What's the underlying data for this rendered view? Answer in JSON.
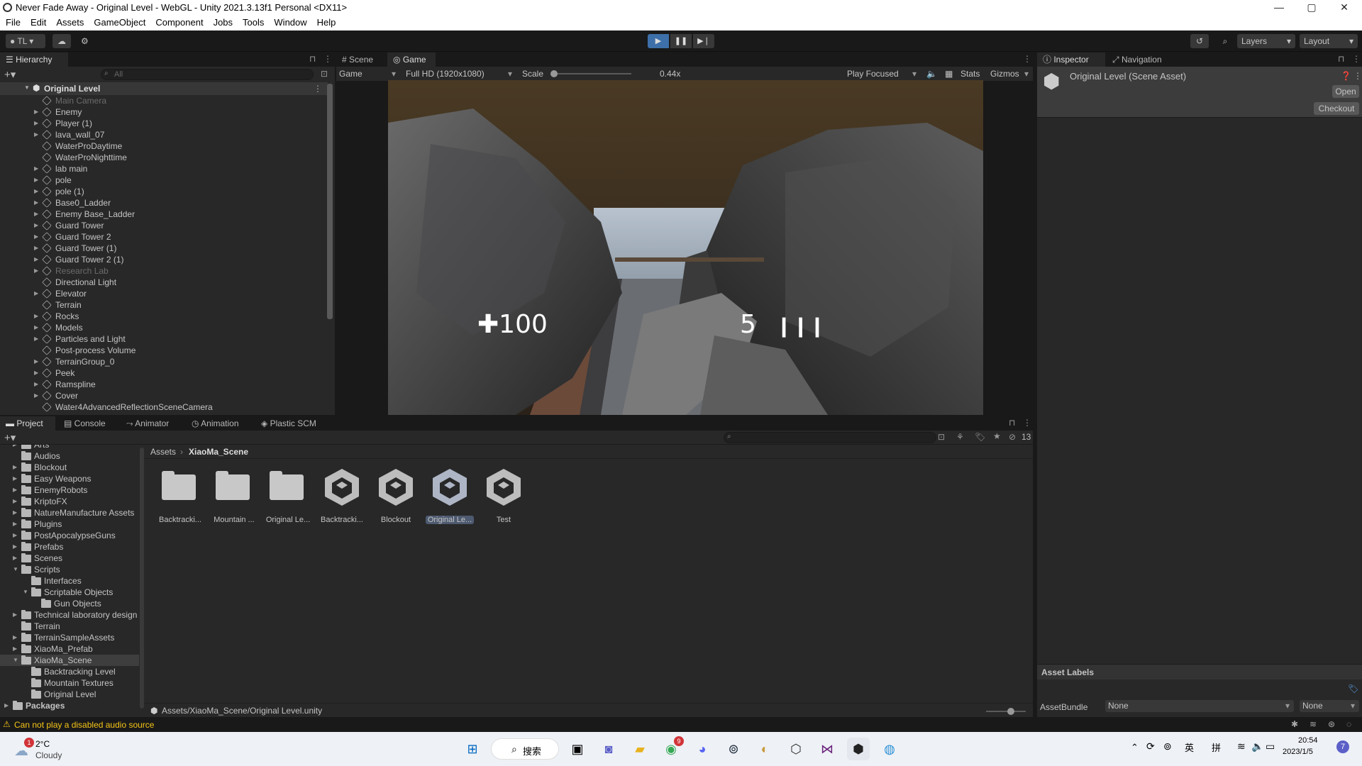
{
  "window": {
    "title": "Never Fade Away - Original Level - WebGL - Unity 2021.3.13f1 Personal <DX11>",
    "controls": [
      "—",
      "▢",
      "✕"
    ]
  },
  "menu": [
    "File",
    "Edit",
    "Assets",
    "GameObject",
    "Component",
    "Jobs",
    "Tools",
    "Window",
    "Help"
  ],
  "toolbar": {
    "account": "TL",
    "layers": "Layers",
    "layout": "Layout"
  },
  "hierarchy": {
    "tab": "Hierarchy",
    "search_placeholder": "All",
    "root": "Original Level",
    "items": [
      {
        "label": "Main Camera",
        "dim": true,
        "arrow": false
      },
      {
        "label": "Enemy",
        "dim": false,
        "arrow": true
      },
      {
        "label": "Player (1)",
        "dim": false,
        "arrow": true
      },
      {
        "label": "lava_wall_07",
        "dim": false,
        "arrow": true
      },
      {
        "label": "WaterProDaytime",
        "dim": false,
        "arrow": false
      },
      {
        "label": "WaterProNighttime",
        "dim": false,
        "arrow": false
      },
      {
        "label": "lab main",
        "dim": false,
        "arrow": true
      },
      {
        "label": "pole",
        "dim": false,
        "arrow": true
      },
      {
        "label": "pole (1)",
        "dim": false,
        "arrow": true
      },
      {
        "label": "Base0_Ladder",
        "dim": false,
        "arrow": true
      },
      {
        "label": "Enemy Base_Ladder",
        "dim": false,
        "arrow": true
      },
      {
        "label": "Guard Tower",
        "dim": false,
        "arrow": true
      },
      {
        "label": "Guard Tower 2",
        "dim": false,
        "arrow": true
      },
      {
        "label": "Guard Tower (1)",
        "dim": false,
        "arrow": true
      },
      {
        "label": "Guard Tower 2 (1)",
        "dim": false,
        "arrow": true
      },
      {
        "label": "Research Lab",
        "dim": true,
        "arrow": true
      },
      {
        "label": "Directional Light",
        "dim": false,
        "arrow": false
      },
      {
        "label": "Elevator",
        "dim": false,
        "arrow": true
      },
      {
        "label": "Terrain",
        "dim": false,
        "arrow": false
      },
      {
        "label": "Rocks",
        "dim": false,
        "arrow": true
      },
      {
        "label": "Models",
        "dim": false,
        "arrow": true
      },
      {
        "label": "Particles and Light",
        "dim": false,
        "arrow": true
      },
      {
        "label": "Post-process Volume",
        "dim": false,
        "arrow": false
      },
      {
        "label": "TerrainGroup_0",
        "dim": false,
        "arrow": true
      },
      {
        "label": "Peek",
        "dim": false,
        "arrow": true
      },
      {
        "label": "Ramspline",
        "dim": false,
        "arrow": true
      },
      {
        "label": "Cover",
        "dim": false,
        "arrow": true
      },
      {
        "label": "Water4AdvancedReflectionSceneCamera",
        "dim": false,
        "arrow": false
      }
    ]
  },
  "gameview": {
    "tabs": [
      "Scene",
      "Game"
    ],
    "display": "Game",
    "resolution": "Full HD (1920x1080)",
    "scale_label": "Scale",
    "scale_value": "0.44x",
    "play_mode": "Play Focused",
    "stats": "Stats",
    "gizmos": "Gizmos",
    "hud_health": "100",
    "hud_ammo": "5"
  },
  "inspector": {
    "tabs": [
      "Inspector",
      "Navigation"
    ],
    "asset_name": "Original Level (Scene Asset)",
    "open": "Open",
    "checkout": "Checkout",
    "asset_labels": "Asset Labels",
    "assetbundle_label": "AssetBundle",
    "assetbundle_value": "None",
    "variant_value": "None"
  },
  "project": {
    "tabs": [
      "Project",
      "Console",
      "Animator",
      "Animation",
      "Plastic SCM"
    ],
    "hidden_count": "13",
    "breadcrumb_root": "Assets",
    "breadcrumb_current": "XiaoMa_Scene",
    "tree": [
      {
        "label": "Arts",
        "indent": 0,
        "arrow": "▶"
      },
      {
        "label": "Audios",
        "indent": 0,
        "arrow": ""
      },
      {
        "label": "Blockout",
        "indent": 0,
        "arrow": "▶"
      },
      {
        "label": "Easy Weapons",
        "indent": 0,
        "arrow": "▶"
      },
      {
        "label": "EnemyRobots",
        "indent": 0,
        "arrow": "▶"
      },
      {
        "label": "KriptoFX",
        "indent": 0,
        "arrow": "▶"
      },
      {
        "label": "NatureManufacture Assets",
        "indent": 0,
        "arrow": "▶"
      },
      {
        "label": "Plugins",
        "indent": 0,
        "arrow": "▶"
      },
      {
        "label": "PostApocalypseGuns",
        "indent": 0,
        "arrow": "▶"
      },
      {
        "label": "Prefabs",
        "indent": 0,
        "arrow": "▶"
      },
      {
        "label": "Scenes",
        "indent": 0,
        "arrow": "▶"
      },
      {
        "label": "Scripts",
        "indent": 0,
        "arrow": "▼"
      },
      {
        "label": "Interfaces",
        "indent": 1,
        "arrow": ""
      },
      {
        "label": "Scriptable Objects",
        "indent": 1,
        "arrow": "▼"
      },
      {
        "label": "Gun Objects",
        "indent": 2,
        "arrow": ""
      },
      {
        "label": "Technical laboratory design",
        "indent": 0,
        "arrow": "▶"
      },
      {
        "label": "Terrain",
        "indent": 0,
        "arrow": ""
      },
      {
        "label": "TerrainSampleAssets",
        "indent": 0,
        "arrow": "▶"
      },
      {
        "label": "XiaoMa_Prefab",
        "indent": 0,
        "arrow": "▶"
      },
      {
        "label": "XiaoMa_Scene",
        "indent": 0,
        "arrow": "▼",
        "selected": true
      },
      {
        "label": "Backtracking Level",
        "indent": 1,
        "arrow": ""
      },
      {
        "label": "Mountain Textures",
        "indent": 1,
        "arrow": ""
      },
      {
        "label": "Original Level",
        "indent": 1,
        "arrow": ""
      }
    ],
    "packages": "Packages",
    "assets": [
      {
        "label": "Backtracki...",
        "kind": "folder"
      },
      {
        "label": "Mountain ...",
        "kind": "folder"
      },
      {
        "label": "Original Le...",
        "kind": "folder"
      },
      {
        "label": "Backtracki...",
        "kind": "unity"
      },
      {
        "label": "Blockout",
        "kind": "unity"
      },
      {
        "label": "Original Le...",
        "kind": "unity",
        "selected": true
      },
      {
        "label": "Test",
        "kind": "unity"
      }
    ],
    "path": "Assets/XiaoMa_Scene/Original Level.unity"
  },
  "status": {
    "message": "Can not play a disabled audio source"
  },
  "taskbar": {
    "weather_temp": "2°C",
    "weather_desc": "Cloudy",
    "weather_badge": "1",
    "search": "搜索",
    "ime1": "英",
    "ime2": "拼",
    "time": "20:54",
    "date": "2023/1/5",
    "notif": "7",
    "chrome_badge": "9"
  }
}
